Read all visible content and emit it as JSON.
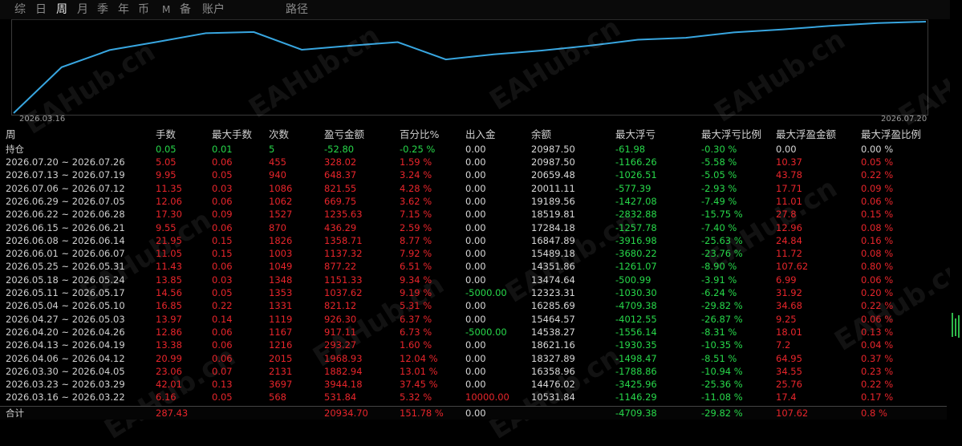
{
  "tabs": [
    {
      "label": "综"
    },
    {
      "label": "日"
    },
    {
      "label": "周"
    },
    {
      "label": "月"
    },
    {
      "label": "季"
    },
    {
      "label": "年"
    },
    {
      "label": "币"
    },
    {
      "label": "M"
    },
    {
      "label": "备"
    },
    {
      "label": "账户"
    },
    {
      "label": "路径"
    }
  ],
  "active_tab": "周",
  "watermark": "EAHub.cn",
  "chart": {
    "start_date": "2026.03.16",
    "end_date": "2026.07.20",
    "line_color": "#38a6e0",
    "balance_series": [
      0.0,
      10531.84,
      14476.02,
      16358.96,
      18327.89,
      18621.16,
      14538.27,
      15464.57,
      16285.69,
      12323.31,
      13474.64,
      14351.86,
      15489.18,
      16847.89,
      17284.18,
      18519.81,
      19189.56,
      20011.11,
      20659.48,
      20987.5
    ]
  },
  "headers": {
    "period": "周",
    "lots": "手数",
    "max_lots": "最大手数",
    "trades": "次数",
    "pnl": "盈亏金额",
    "pct": "百分比%",
    "deposit": "出入金",
    "balance": "余额",
    "max_dd": "最大浮亏",
    "max_dd_pct": "最大浮亏比例",
    "max_fp": "最大浮盈金额",
    "max_fp_pct": "最大浮盈比例"
  },
  "position_row": {
    "label": "持仓",
    "lots": "0.05",
    "max_lots": "0.01",
    "trades": "5",
    "pnl": "-52.80",
    "pct": "-0.25 %",
    "deposit": "0.00",
    "balance": "20987.50",
    "max_dd": "-61.98",
    "max_dd_pct": "-0.30 %",
    "max_fp": "0.00",
    "max_fp_pct": "0.00 %"
  },
  "rows": [
    {
      "period": "2026.07.20 ~ 2026.07.26",
      "lots": "5.05",
      "max_lots": "0.06",
      "trades": "455",
      "pnl": "328.02",
      "pct": "1.59 %",
      "deposit": "0.00",
      "balance": "20987.50",
      "max_dd": "-1166.26",
      "max_dd_pct": "-5.58 %",
      "max_fp": "10.37",
      "max_fp_pct": "0.05 %"
    },
    {
      "period": "2026.07.13 ~ 2026.07.19",
      "lots": "9.95",
      "max_lots": "0.05",
      "trades": "940",
      "pnl": "648.37",
      "pct": "3.24 %",
      "deposit": "0.00",
      "balance": "20659.48",
      "max_dd": "-1026.51",
      "max_dd_pct": "-5.05 %",
      "max_fp": "43.78",
      "max_fp_pct": "0.22 %"
    },
    {
      "period": "2026.07.06 ~ 2026.07.12",
      "lots": "11.35",
      "max_lots": "0.03",
      "trades": "1086",
      "pnl": "821.55",
      "pct": "4.28 %",
      "deposit": "0.00",
      "balance": "20011.11",
      "max_dd": "-577.39",
      "max_dd_pct": "-2.93 %",
      "max_fp": "17.71",
      "max_fp_pct": "0.09 %"
    },
    {
      "period": "2026.06.29 ~ 2026.07.05",
      "lots": "12.06",
      "max_lots": "0.06",
      "trades": "1062",
      "pnl": "669.75",
      "pct": "3.62 %",
      "deposit": "0.00",
      "balance": "19189.56",
      "max_dd": "-1427.08",
      "max_dd_pct": "-7.49 %",
      "max_fp": "11.01",
      "max_fp_pct": "0.06 %"
    },
    {
      "period": "2026.06.22 ~ 2026.06.28",
      "lots": "17.30",
      "max_lots": "0.09",
      "trades": "1527",
      "pnl": "1235.63",
      "pct": "7.15 %",
      "deposit": "0.00",
      "balance": "18519.81",
      "max_dd": "-2832.88",
      "max_dd_pct": "-15.75 %",
      "max_fp": "27.8",
      "max_fp_pct": "0.15 %"
    },
    {
      "period": "2026.06.15 ~ 2026.06.21",
      "lots": "9.55",
      "max_lots": "0.06",
      "trades": "870",
      "pnl": "436.29",
      "pct": "2.59 %",
      "deposit": "0.00",
      "balance": "17284.18",
      "max_dd": "-1257.78",
      "max_dd_pct": "-7.40 %",
      "max_fp": "12.96",
      "max_fp_pct": "0.08 %"
    },
    {
      "period": "2026.06.08 ~ 2026.06.14",
      "lots": "21.95",
      "max_lots": "0.15",
      "trades": "1826",
      "pnl": "1358.71",
      "pct": "8.77 %",
      "deposit": "0.00",
      "balance": "16847.89",
      "max_dd": "-3916.98",
      "max_dd_pct": "-25.63 %",
      "max_fp": "24.84",
      "max_fp_pct": "0.16 %"
    },
    {
      "period": "2026.06.01 ~ 2026.06.07",
      "lots": "11.05",
      "max_lots": "0.15",
      "trades": "1003",
      "pnl": "1137.32",
      "pct": "7.92 %",
      "deposit": "0.00",
      "balance": "15489.18",
      "max_dd": "-3680.22",
      "max_dd_pct": "-23.76 %",
      "max_fp": "11.72",
      "max_fp_pct": "0.08 %"
    },
    {
      "period": "2026.05.25 ~ 2026.05.31",
      "lots": "11.43",
      "max_lots": "0.06",
      "trades": "1049",
      "pnl": "877.22",
      "pct": "6.51 %",
      "deposit": "0.00",
      "balance": "14351.86",
      "max_dd": "-1261.07",
      "max_dd_pct": "-8.90 %",
      "max_fp": "107.62",
      "max_fp_pct": "0.80 %"
    },
    {
      "period": "2026.05.18 ~ 2026.05.24",
      "lots": "13.85",
      "max_lots": "0.03",
      "trades": "1348",
      "pnl": "1151.33",
      "pct": "9.34 %",
      "deposit": "0.00",
      "balance": "13474.64",
      "max_dd": "-500.99",
      "max_dd_pct": "-3.91 %",
      "max_fp": "6.99",
      "max_fp_pct": "0.06 %"
    },
    {
      "period": "2026.05.11 ~ 2026.05.17",
      "lots": "14.56",
      "max_lots": "0.05",
      "trades": "1353",
      "pnl": "1037.62",
      "pct": "9.19 %",
      "deposit": "-5000.00",
      "balance": "12323.31",
      "max_dd": "-1030.30",
      "max_dd_pct": "-6.24 %",
      "max_fp": "31.92",
      "max_fp_pct": "0.20 %"
    },
    {
      "period": "2026.05.04 ~ 2026.05.10",
      "lots": "16.85",
      "max_lots": "0.22",
      "trades": "1331",
      "pnl": "821.12",
      "pct": "5.31 %",
      "deposit": "0.00",
      "balance": "16285.69",
      "max_dd": "-4709.38",
      "max_dd_pct": "-29.82 %",
      "max_fp": "34.68",
      "max_fp_pct": "0.22 %"
    },
    {
      "period": "2026.04.27 ~ 2026.05.03",
      "lots": "13.97",
      "max_lots": "0.14",
      "trades": "1119",
      "pnl": "926.30",
      "pct": "6.37 %",
      "deposit": "0.00",
      "balance": "15464.57",
      "max_dd": "-4012.55",
      "max_dd_pct": "-26.87 %",
      "max_fp": "9.25",
      "max_fp_pct": "0.06 %"
    },
    {
      "period": "2026.04.20 ~ 2026.04.26",
      "lots": "12.86",
      "max_lots": "0.06",
      "trades": "1167",
      "pnl": "917.11",
      "pct": "6.73 %",
      "deposit": "-5000.00",
      "balance": "14538.27",
      "max_dd": "-1556.14",
      "max_dd_pct": "-8.31 %",
      "max_fp": "18.01",
      "max_fp_pct": "0.13 %"
    },
    {
      "period": "2026.04.13 ~ 2026.04.19",
      "lots": "13.38",
      "max_lots": "0.06",
      "trades": "1216",
      "pnl": "293.27",
      "pct": "1.60 %",
      "deposit": "0.00",
      "balance": "18621.16",
      "max_dd": "-1930.35",
      "max_dd_pct": "-10.35 %",
      "max_fp": "7.2",
      "max_fp_pct": "0.04 %"
    },
    {
      "period": "2026.04.06 ~ 2026.04.12",
      "lots": "20.99",
      "max_lots": "0.06",
      "trades": "2015",
      "pnl": "1968.93",
      "pct": "12.04 %",
      "deposit": "0.00",
      "balance": "18327.89",
      "max_dd": "-1498.47",
      "max_dd_pct": "-8.51 %",
      "max_fp": "64.95",
      "max_fp_pct": "0.37 %"
    },
    {
      "period": "2026.03.30 ~ 2026.04.05",
      "lots": "23.06",
      "max_lots": "0.07",
      "trades": "2131",
      "pnl": "1882.94",
      "pct": "13.01 %",
      "deposit": "0.00",
      "balance": "16358.96",
      "max_dd": "-1788.86",
      "max_dd_pct": "-10.94 %",
      "max_fp": "34.55",
      "max_fp_pct": "0.23 %"
    },
    {
      "period": "2026.03.23 ~ 2026.03.29",
      "lots": "42.01",
      "max_lots": "0.13",
      "trades": "3697",
      "pnl": "3944.18",
      "pct": "37.45 %",
      "deposit": "0.00",
      "balance": "14476.02",
      "max_dd": "-3425.96",
      "max_dd_pct": "-25.36 %",
      "max_fp": "25.76",
      "max_fp_pct": "0.22 %"
    },
    {
      "period": "2026.03.16 ~ 2026.03.22",
      "lots": "6.16",
      "max_lots": "0.05",
      "trades": "568",
      "pnl": "531.84",
      "pct": "5.32 %",
      "deposit": "10000.00",
      "balance": "10531.84",
      "max_dd": "-1146.29",
      "max_dd_pct": "-11.08 %",
      "max_fp": "17.4",
      "max_fp_pct": "0.17 %"
    }
  ],
  "total_row": {
    "label": "合计",
    "lots": "287.43",
    "pnl": "20934.70",
    "pct": "151.78 %",
    "deposit": "0.00",
    "max_dd": "-4709.38",
    "max_dd_pct": "-29.82 %",
    "max_fp": "107.62",
    "max_fp_pct": "0.8 %"
  }
}
